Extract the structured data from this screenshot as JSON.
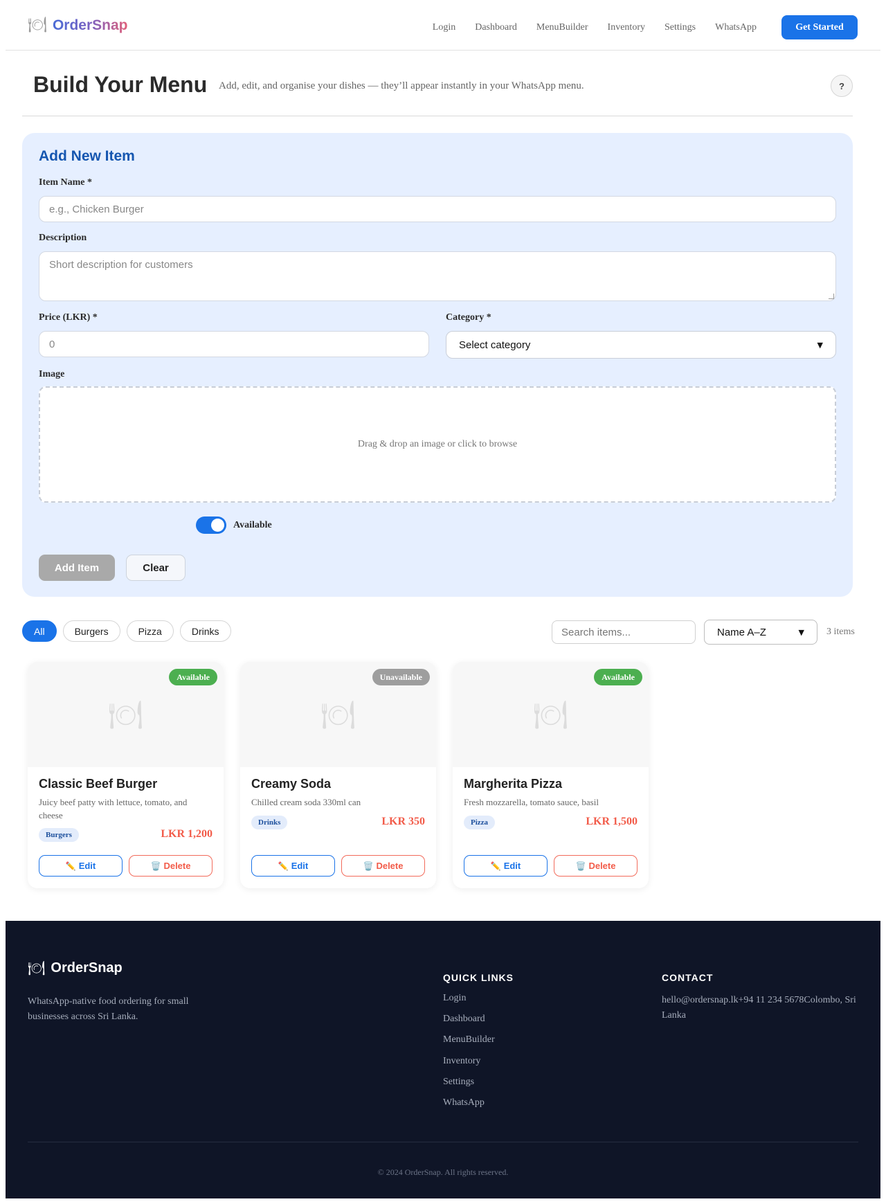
{
  "header": {
    "logo_icon": "plate-cutlery-icon",
    "brand": "OrderSnap",
    "nav": [
      "Login",
      "Dashboard",
      "MenuBuilder",
      "Inventory",
      "Settings",
      "WhatsApp"
    ],
    "cta": "Get Started"
  },
  "page": {
    "title": "Build Your Menu",
    "subtitle": "Add, edit, and organise your dishes — they’ll appear instantly in your WhatsApp menu.",
    "help": "?"
  },
  "form": {
    "heading": "Add New Item",
    "name_label": "Item Name *",
    "name_placeholder": "e.g., Chicken Burger",
    "desc_label": "Description",
    "desc_placeholder": "Short description for customers",
    "price_label": "Price (LKR) *",
    "price_placeholder": "0",
    "category_label": "Category *",
    "category_value": "Select category",
    "image_label": "Image",
    "image_drop": "Drag & drop an image or click to browse",
    "available_label": "Available",
    "available": true,
    "add_button": "Add Item",
    "clear_button": "Clear"
  },
  "filters": {
    "chips": [
      "All",
      "Burgers",
      "Pizza",
      "Drinks"
    ],
    "active": "All",
    "search_placeholder": "Search items...",
    "sort_value": "Name A–Z",
    "count": "3 items"
  },
  "items": [
    {
      "name": "Classic Beef Burger",
      "description": "Juicy beef patty with lettuce, tomato, and cheese",
      "category": "Burgers",
      "price": "LKR 1,200",
      "status": "Available",
      "edit": "Edit",
      "delete": "Delete"
    },
    {
      "name": "Creamy Soda",
      "description": "Chilled cream soda 330ml can",
      "category": "Drinks",
      "price": "LKR 350",
      "status": "Unavailable",
      "edit": "Edit",
      "delete": "Delete"
    },
    {
      "name": "Margherita Pizza",
      "description": "Fresh mozzarella, tomato sauce, basil",
      "category": "Pizza",
      "price": "LKR 1,500",
      "status": "Available",
      "edit": "Edit",
      "delete": "Delete"
    }
  ],
  "footer": {
    "brand": "OrderSnap",
    "tagline": "WhatsApp-native food ordering for small businesses across Sri Lanka.",
    "links_heading": "QUICK LINKS",
    "links": [
      "Login",
      "Dashboard",
      "MenuBuilder",
      "Inventory",
      "Settings",
      "WhatsApp"
    ],
    "contact_heading": "CONTACT",
    "contact": "hello@ordersnap.lk+94 11 234 5678Colombo, Sri Lanka",
    "copyright": "© 2024 OrderSnap. All rights reserved."
  },
  "colors": {
    "accent": "#1a73e8",
    "form_bg": "#e6efff",
    "price": "#f25c4a",
    "available": "#4caf50",
    "unavailable": "#9e9e9e",
    "footer_bg": "#0f1527"
  }
}
